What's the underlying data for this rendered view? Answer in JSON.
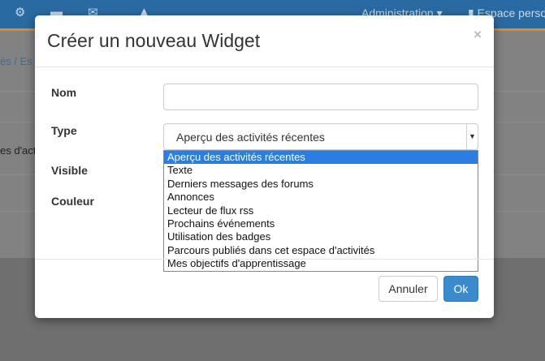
{
  "topbar": {
    "icons": [
      "gears-icon",
      "folder-icon",
      "mail-icon",
      "bell-icon"
    ],
    "admin_label": "Administration",
    "espace_label": "Espace perso"
  },
  "background": {
    "breadcrumb": "és /  Es",
    "partial_text": "es d'act"
  },
  "modal": {
    "title": "Créer un nouveau Widget",
    "close": "×",
    "labels": {
      "nom": "Nom",
      "type": "Type",
      "visible": "Visible",
      "couleur": "Couleur"
    },
    "nom_value": "",
    "type_selected": "Aperçu des activités récentes",
    "type_options": [
      "Aperçu des activités récentes",
      "Texte",
      "Derniers messages des forums",
      "Annonces",
      "Lecteur de flux rss",
      "Prochains événements",
      "Utilisation des badges",
      "Parcours publiés dans cet espace d'activités",
      "Mes objectifs d'apprentissage"
    ],
    "buttons": {
      "cancel": "Annuler",
      "ok": "Ok"
    }
  }
}
